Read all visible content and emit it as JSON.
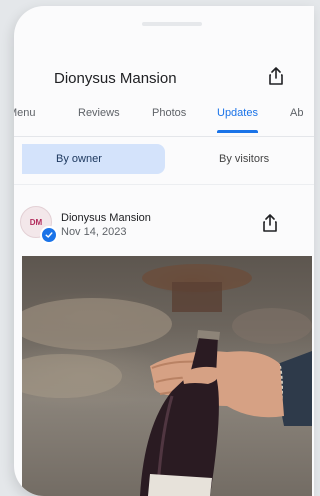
{
  "header": {
    "title": "Dionysus Mansion"
  },
  "tabs": [
    {
      "label": "Menu",
      "active": false
    },
    {
      "label": "Reviews",
      "active": false
    },
    {
      "label": "Photos",
      "active": false
    },
    {
      "label": "Updates",
      "active": true
    },
    {
      "label": "Ab",
      "active": false
    }
  ],
  "filter": {
    "owner_label": "By owner",
    "visitors_label": "By visitors",
    "selected": "owner"
  },
  "post": {
    "author": "Dionysus Mansion",
    "date": "Nov 14, 2023",
    "avatar_text": "DM",
    "photo_description": "hand holding red wine bottle"
  },
  "colors": {
    "accent": "#1a73e8",
    "selected_chip": "#d4e3fb",
    "background": "#fbfbfc"
  },
  "icons": [
    "share-icon",
    "verified-badge-icon"
  ]
}
